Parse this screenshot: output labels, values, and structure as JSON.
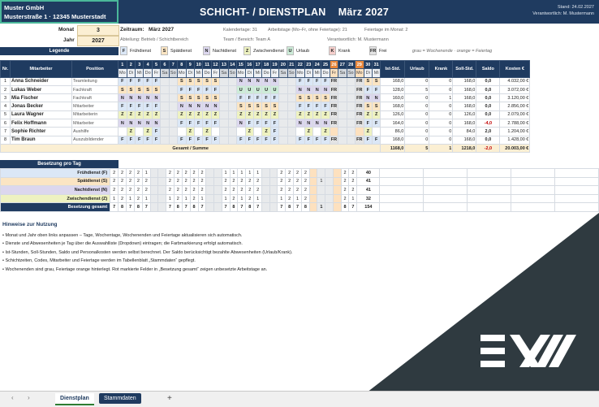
{
  "company": {
    "name": "Muster GmbH",
    "address": "Musterstraße 1 · 12345 Musterstadt"
  },
  "header": {
    "title": "SCHICHT- / DIENSTPLAN",
    "month_title": "März 2027",
    "stand": "Stand: 24.02.2027",
    "verantwortlich": "Verantwortlich: M. Mustermann"
  },
  "inputs": {
    "monat_label": "Monat",
    "monat_value": "3",
    "jahr_label": "Jahr",
    "jahr_value": "2027"
  },
  "info": {
    "zeitraum_label": "Zeitraum:",
    "zeitraum_value": "März 2027",
    "kalendertage": "Kalendertage: 31",
    "arbeitstage": "Arbeitstage (Mo–Fr, ohne Feiertage): 21",
    "feiertage": "Feiertage im Monat: 2",
    "abteilung": "Abteilung:  Betrieb / Schichtbereich",
    "team": "Team / Bereich:  Team A",
    "verantwortlich": "Verantwortlich:  M. Mustermann"
  },
  "legend": {
    "title": "Legende",
    "items": [
      {
        "code": "F",
        "label": "Frühdienst",
        "cls": "F"
      },
      {
        "code": "S",
        "label": "Spätdienst",
        "cls": "S"
      },
      {
        "code": "N",
        "label": "Nachtdienst",
        "cls": "N"
      },
      {
        "code": "Z",
        "label": "Zwischendienst",
        "cls": "Z"
      },
      {
        "code": "U",
        "label": "Urlaub",
        "cls": "U"
      },
      {
        "code": "K",
        "label": "Krank",
        "cls": "K"
      },
      {
        "code": "FR",
        "label": "Frei",
        "cls": "FR"
      }
    ],
    "note": "grau = Wochenende · orange = Feiertag"
  },
  "table": {
    "headers": {
      "nr": "Nr.",
      "mitarbeiter": "Mitarbeiter",
      "position": "Position",
      "ist": "Ist-Std.",
      "urlaub": "Urlaub",
      "krank": "Krank",
      "soll": "Soll-Std.",
      "saldo": "Saldo",
      "kosten": "Kosten €"
    },
    "days": [
      "1",
      "2",
      "3",
      "4",
      "5",
      "6",
      "7",
      "8",
      "9",
      "10",
      "11",
      "12",
      "13",
      "14",
      "15",
      "16",
      "17",
      "18",
      "19",
      "20",
      "21",
      "22",
      "23",
      "24",
      "25",
      "26",
      "27",
      "28",
      "29",
      "30",
      "31"
    ],
    "weekdays": [
      "Mo",
      "Di",
      "Mi",
      "Do",
      "Fr",
      "Sa",
      "So",
      "Mo",
      "Di",
      "Mi",
      "Do",
      "Fr",
      "Sa",
      "So",
      "Mo",
      "Di",
      "Mi",
      "Do",
      "Fr",
      "Sa",
      "So",
      "Mo",
      "Di",
      "Mi",
      "Do",
      "Fr",
      "Sa",
      "So",
      "Mo",
      "Di",
      "Mi"
    ],
    "rows": [
      {
        "nr": "1",
        "name": "Anna Schneider",
        "position": "Teamleitung",
        "shifts": [
          "F",
          "F",
          "F",
          "F",
          "F",
          "",
          "",
          "S",
          "S",
          "S",
          "S",
          "S",
          "",
          "",
          "N",
          "N",
          "N",
          "N",
          "N",
          "",
          "",
          "F",
          "F",
          "F",
          "F",
          "FR",
          "",
          "",
          "FR",
          "S",
          "S"
        ],
        "ist": "168,0",
        "urlaub": "0",
        "krank": "0",
        "soll": "168,0",
        "saldo": "0,0",
        "kosten": "4.032,00 €"
      },
      {
        "nr": "2",
        "name": "Lukas Weber",
        "position": "Fachkraft",
        "shifts": [
          "S",
          "S",
          "S",
          "S",
          "S",
          "",
          "",
          "F",
          "F",
          "F",
          "F",
          "F",
          "",
          "",
          "U",
          "U",
          "U",
          "U",
          "U",
          "",
          "",
          "N",
          "N",
          "N",
          "N",
          "FR",
          "",
          "",
          "FR",
          "F",
          "F"
        ],
        "ist": "128,0",
        "urlaub": "5",
        "krank": "0",
        "soll": "168,0",
        "saldo": "0,0",
        "kosten": "3.072,00 €"
      },
      {
        "nr": "3",
        "name": "Mia Fischer",
        "position": "Fachkraft",
        "shifts": [
          "N",
          "N",
          "N",
          "N",
          "N",
          "",
          "",
          "S",
          "S",
          "S",
          "S",
          "S",
          "",
          "",
          "F",
          "F",
          "F",
          "F",
          "F",
          "",
          "",
          "S",
          "S",
          "S",
          "S",
          "FR",
          "",
          "",
          "FR",
          "N",
          "N"
        ],
        "ist": "160,0",
        "urlaub": "0",
        "krank": "1",
        "soll": "168,0",
        "saldo": "0,0",
        "kosten": "3.120,00 €"
      },
      {
        "nr": "4",
        "name": "Jonas Becker",
        "position": "Mitarbeiter",
        "shifts": [
          "F",
          "F",
          "F",
          "F",
          "F",
          "",
          "",
          "N",
          "N",
          "N",
          "N",
          "N",
          "",
          "",
          "S",
          "S",
          "S",
          "S",
          "S",
          "",
          "",
          "F",
          "F",
          "F",
          "F",
          "FR",
          "",
          "",
          "FR",
          "S",
          "S"
        ],
        "ist": "168,0",
        "urlaub": "0",
        "krank": "0",
        "soll": "168,0",
        "saldo": "0,0",
        "kosten": "2.856,00 €"
      },
      {
        "nr": "5",
        "name": "Laura Wagner",
        "position": "Mitarbeiterin",
        "shifts": [
          "Z",
          "Z",
          "Z",
          "Z",
          "Z",
          "",
          "",
          "Z",
          "Z",
          "Z",
          "Z",
          "Z",
          "",
          "",
          "Z",
          "Z",
          "Z",
          "Z",
          "Z",
          "",
          "",
          "Z",
          "Z",
          "Z",
          "Z",
          "FR",
          "",
          "",
          "FR",
          "Z",
          "Z"
        ],
        "ist": "126,0",
        "urlaub": "0",
        "krank": "0",
        "soll": "126,0",
        "saldo": "0,0",
        "kosten": "2.079,00 €"
      },
      {
        "nr": "6",
        "name": "Felix Hoffmann",
        "position": "Mitarbeiter",
        "shifts": [
          "N",
          "N",
          "N",
          "N",
          "N",
          "",
          "",
          "F",
          "F",
          "F",
          "F",
          "F",
          "",
          "",
          "N",
          "F",
          "F",
          "F",
          "F",
          "",
          "",
          "N",
          "N",
          "N",
          "N",
          "FR",
          "",
          "",
          "FR",
          "F",
          "F"
        ],
        "ist": "164,0",
        "urlaub": "0",
        "krank": "0",
        "soll": "168,0",
        "saldo": "-4,0",
        "kosten": "2.788,00 €"
      },
      {
        "nr": "7",
        "name": "Sophie Richter",
        "position": "Aushilfe",
        "shifts": [
          "",
          "Z",
          "",
          "Z",
          "F",
          "",
          "",
          "",
          "Z",
          "",
          "Z",
          "",
          "",
          "",
          "",
          "Z",
          "",
          "Z",
          "F",
          "",
          "",
          "",
          "Z",
          "",
          "Z",
          "",
          "",
          "",
          "",
          "Z",
          ""
        ],
        "ist": "86,0",
        "urlaub": "0",
        "krank": "0",
        "soll": "84,0",
        "saldo": "2,0",
        "kosten": "1.204,00 €"
      },
      {
        "nr": "8",
        "name": "Tim Braun",
        "position": "Auszubildender",
        "shifts": [
          "F",
          "F",
          "F",
          "F",
          "F",
          "",
          "",
          "F",
          "F",
          "F",
          "F",
          "F",
          "",
          "",
          "F",
          "F",
          "F",
          "F",
          "F",
          "",
          "",
          "F",
          "F",
          "F",
          "F",
          "FR",
          "",
          "",
          "FR",
          "F",
          "F"
        ],
        "ist": "168,0",
        "urlaub": "0",
        "krank": "0",
        "soll": "168,0",
        "saldo": "0,0",
        "kosten": "1.428,00 €"
      }
    ],
    "total": {
      "label": "Gesamt / Summe",
      "ist": "1168,0",
      "urlaub": "5",
      "krank": "1",
      "soll": "1218,0",
      "saldo": "-2,0",
      "kosten": "20.003,00 €"
    }
  },
  "occupancy": {
    "title": "Besetzung pro Tag",
    "rows": [
      {
        "label": "Frühdienst (F)",
        "values": [
          "2",
          "2",
          "2",
          "2",
          "1",
          "",
          "",
          "2",
          "2",
          "2",
          "2",
          "2",
          "",
          "",
          "1",
          "1",
          "1",
          "1",
          "1",
          "",
          "",
          "2",
          "2",
          "2",
          "2",
          "",
          "",
          "",
          "",
          "2",
          "2"
        ],
        "sum": "40"
      },
      {
        "label": "Spätdienst (S)",
        "values": [
          "2",
          "2",
          "2",
          "2",
          "2",
          "",
          "",
          "2",
          "2",
          "2",
          "2",
          "2",
          "",
          "",
          "2",
          "2",
          "2",
          "2",
          "2",
          "",
          "",
          "2",
          "2",
          "2",
          "2",
          "",
          "1",
          "",
          "",
          "2",
          "2"
        ],
        "sum": "41"
      },
      {
        "label": "Nachtdienst (N)",
        "values": [
          "2",
          "2",
          "2",
          "2",
          "2",
          "",
          "",
          "2",
          "2",
          "2",
          "2",
          "2",
          "",
          "",
          "2",
          "2",
          "2",
          "2",
          "2",
          "",
          "",
          "2",
          "2",
          "2",
          "2",
          "",
          "",
          "",
          "",
          "2",
          "2"
        ],
        "sum": "41"
      },
      {
        "label": "Zwischendienst (Z)",
        "values": [
          "1",
          "2",
          "1",
          "2",
          "1",
          "",
          "",
          "1",
          "2",
          "1",
          "2",
          "1",
          "",
          "",
          "1",
          "2",
          "1",
          "2",
          "1",
          "",
          "",
          "1",
          "2",
          "1",
          "2",
          "",
          "",
          "",
          "",
          "2",
          "1"
        ],
        "sum": "32"
      },
      {
        "label": "Besetzung gesamt",
        "values": [
          "7",
          "8",
          "7",
          "8",
          "7",
          "",
          "",
          "7",
          "8",
          "7",
          "8",
          "7",
          "",
          "",
          "7",
          "8",
          "7",
          "8",
          "7",
          "",
          "",
          "7",
          "8",
          "7",
          "8",
          "",
          "1",
          "",
          "",
          "8",
          "7"
        ],
        "sum": "154"
      }
    ]
  },
  "hints": {
    "title": "Hinweise zur Nutzung",
    "items": [
      "Monat und Jahr oben links anpassen – Tage, Wochentage, Wochenenden und Feiertage aktualisieren sich automatisch.",
      "Dienste und Abwesenheiten je Tag über die Auswahlliste (Dropdown) eintragen; die Farbmarkierung erfolgt automatisch.",
      "Ist-Stunden, Soll-Stunden, Saldo und Personalkosten werden selbst berechnet. Der Saldo berücksichtigt bezahlte Abwesenheiten (Urlaub/Krank).",
      "Schichtzeiten, Codes, Mitarbeiter und Feiertage werden im Tabellenblatt „Stammdaten“ gepflegt.",
      "Wochenenden sind grau, Feiertage orange hinterlegt. Rot markierte Felder in „Besetzung gesamt“ zeigen unbesetzte Arbeitstage an."
    ]
  },
  "tabs": {
    "sheet1": "Dienstplan",
    "sheet2": "Stammdaten",
    "add": "+"
  },
  "brand": {
    "logo_text": "EX",
    "color_dark": "#2f3a40",
    "color_header": "#1f3b60"
  }
}
